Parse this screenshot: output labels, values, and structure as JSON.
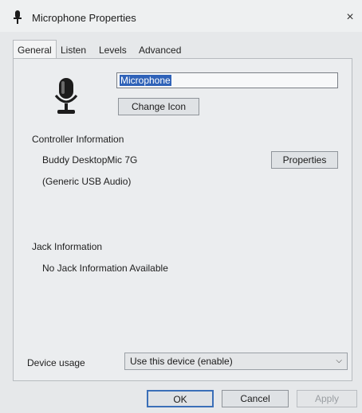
{
  "window": {
    "title": "Microphone Properties",
    "close_glyph": "×"
  },
  "tabs": [
    {
      "label": "General"
    },
    {
      "label": "Listen"
    },
    {
      "label": "Levels"
    },
    {
      "label": "Advanced"
    }
  ],
  "general": {
    "device_name": "Microphone",
    "change_icon_label": "Change Icon",
    "controller_heading": "Controller Information",
    "controller_name": "Buddy DesktopMic 7G",
    "controller_driver": "(Generic USB Audio)",
    "properties_label": "Properties",
    "jack_heading": "Jack Information",
    "jack_value": "No Jack Information Available",
    "device_usage_label": "Device usage",
    "device_usage_value": "Use this device (enable)"
  },
  "footer": {
    "ok_label": "OK",
    "cancel_label": "Cancel",
    "apply_label": "Apply"
  },
  "icons": {
    "title": "microphone-icon",
    "device": "microphone-icon",
    "select": "chevron-down-icon"
  },
  "colors": {
    "selection": "#2f62b8",
    "ok_border": "#3b6fb8"
  }
}
